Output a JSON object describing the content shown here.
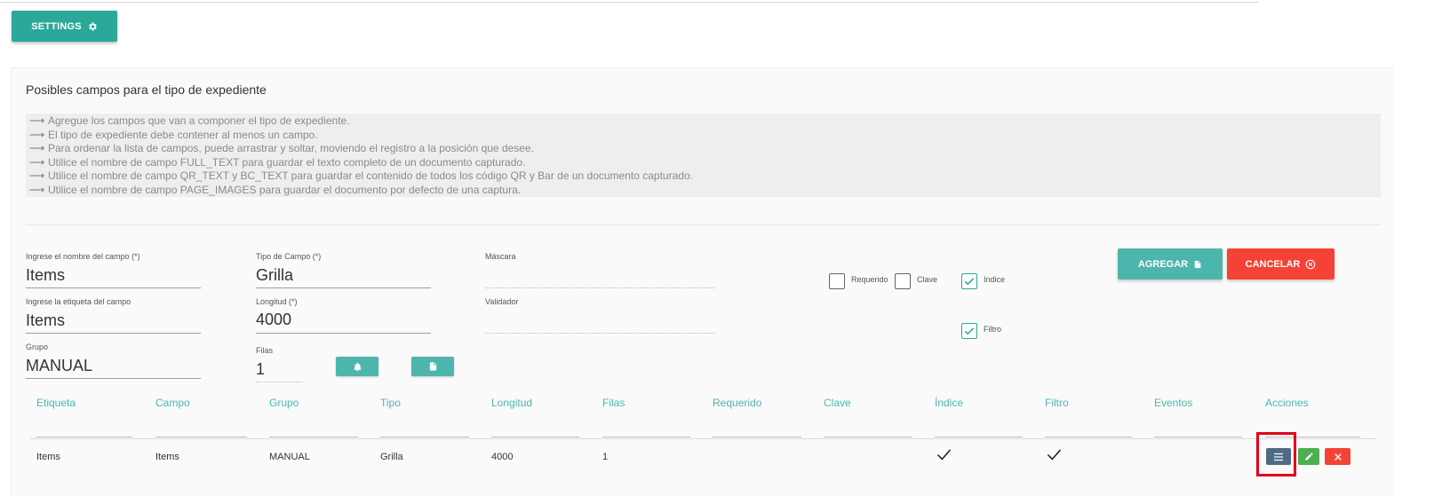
{
  "settings_button": {
    "label": "SETTINGS"
  },
  "panel": {
    "title": "Posibles campos para el tipo de expediente",
    "info_lines": [
      "Agregue los campos que van a componer el tipo de expediente.",
      "El tipo de expediente debe contener al menos un campo.",
      "Para ordenar la lista de campos, puede arrastrar y soltar, moviendo el registro a la posición que desee.",
      "Utilice el nombre de campo FULL_TEXT para guardar el texto completo de un documento capturado.",
      "Utilice el nombre de campo QR_TEXT y BC_TEXT para guardar el contenido de todos los código QR y Bar de un documento capturado.",
      "Utilice el nombre de campo PAGE_IMAGES para guardar el documento por defecto de una captura."
    ],
    "arrow": "⟶"
  },
  "form": {
    "nombre": {
      "label": "Ingrese el nombre del campo (*)",
      "value": "Items"
    },
    "etiqueta": {
      "label": "Ingrese la etiqueta del campo",
      "value": "Items"
    },
    "grupo": {
      "label": "Grupo",
      "value": "MANUAL"
    },
    "tipo": {
      "label": "Tipo de Campo (*)",
      "value": "Grilla"
    },
    "longitud": {
      "label": "Longitud (*)",
      "value": "4000"
    },
    "filas": {
      "label": "Filas",
      "value": "1"
    },
    "mascara": {
      "label": "Máscara",
      "value": ""
    },
    "validador": {
      "label": "Validador",
      "value": ""
    },
    "checkboxes": {
      "requerido": {
        "label": "Requerido",
        "checked": false
      },
      "clave": {
        "label": "Clave",
        "checked": false
      },
      "indice": {
        "label": "Indice",
        "checked": true
      },
      "filtro": {
        "label": "Filtro",
        "checked": true
      }
    },
    "agregar_label": "AGREGAR",
    "cancelar_label": "CANCELAR"
  },
  "table": {
    "headers": [
      "Etiqueta",
      "Campo",
      "Grupo",
      "Tipo",
      "Longitud",
      "Filas",
      "Requerido",
      "Clave",
      "Índice",
      "Filtro",
      "Eventos",
      "Acciones"
    ],
    "rows": [
      {
        "etiqueta": "Items",
        "campo": "Items",
        "grupo": "MANUAL",
        "tipo": "Grilla",
        "longitud": "4000",
        "filas": "1",
        "requerido": false,
        "clave": false,
        "indice": true,
        "filtro": true,
        "eventos": ""
      }
    ]
  },
  "colors": {
    "primary": "#2ba89a",
    "danger": "#f44336",
    "dark_action": "#4e6a85",
    "success": "#4caf50",
    "highlight": "#e0001a"
  }
}
